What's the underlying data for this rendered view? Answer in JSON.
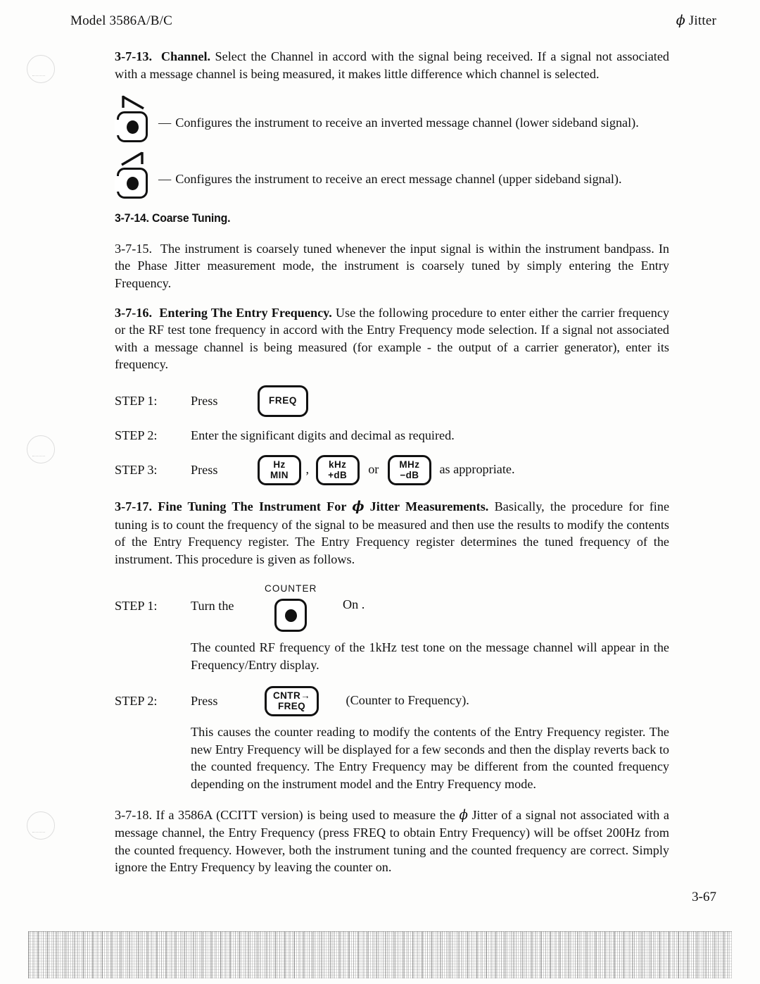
{
  "header": {
    "model": "Model 3586A/B/C",
    "phi": "ϕ",
    "subject": "Jitter"
  },
  "sections": {
    "s13": {
      "number": "3-7-13.",
      "title": "Channel.",
      "body": "Select the Channel in accord with the signal being received. If a signal not associated with a message channel is being measured, it makes little difference which channel is selected."
    },
    "bullets": [
      {
        "icon": "inverted-sideband-slope-icon",
        "dash": "—",
        "text": "Configures the instrument to receive an inverted message channel (lower sideband signal)."
      },
      {
        "icon": "erect-sideband-slope-icon",
        "dash": "—",
        "text": "Configures the instrument to receive an erect message channel (upper sideband signal)."
      }
    ],
    "s14": {
      "heading": "3-7-14.  Coarse Tuning."
    },
    "s15": {
      "number": "3-7-15.",
      "body": "The instrument is coarsely tuned whenever the input signal is within the instrument bandpass. In the Phase Jitter measurement mode, the instrument is coarsely tuned by simply entering the Entry Frequency."
    },
    "s16": {
      "number": "3-7-16.",
      "title": "Entering The Entry Frequency.",
      "body": "Use the following procedure to enter either the carrier frequency or the RF test tone frequency in accord with the Entry Frequency mode selection. If a signal not associated with a message channel is being measured (for example - the output of a carrier generator), enter its frequency.",
      "steps": {
        "step1": {
          "label": "STEP 1:",
          "verb": "Press",
          "key": "FREQ"
        },
        "step2": {
          "label": "STEP 2:",
          "text": "Enter the significant digits and decimal as required."
        },
        "step3": {
          "label": "STEP 3:",
          "verb": "Press",
          "key_hz_line1": "Hz",
          "key_hz_line2": "MIN",
          "separator": ",",
          "key_khz_line1": "kHz",
          "key_khz_line2": "+dB",
          "conjunction": "or",
          "key_mhz_line1": "MHz",
          "key_mhz_line2": "−dB",
          "tail": "as appropriate."
        }
      }
    },
    "s17": {
      "number": "3-7-17.",
      "title_a": "Fine Tuning The Instrument For ",
      "title_phi": "ϕ",
      "title_b": " Jitter Measurements.",
      "body": "Basically, the procedure for fine tuning is to count the frequency of the signal to be measured and then use the results to modify the contents of the Entry Frequency register. The Entry Frequency register determines the tuned frequency of the instrument. This procedure is given as follows.",
      "steps": {
        "step1": {
          "label": "STEP 1:",
          "verb": "Turn the",
          "key_label": "COUNTER",
          "tail": "On  .",
          "note": "The counted RF frequency of the 1kHz test tone on the message channel will appear in the Frequency/Entry display."
        },
        "step2": {
          "label": "STEP 2:",
          "verb": "Press",
          "key_line1": "CNTR→",
          "key_line2": "FREQ",
          "tail": "(Counter to Frequency).",
          "note": "This causes the counter reading to modify the contents of the Entry Frequency register. The new Entry Frequency will be displayed for a few seconds and then the display reverts back to the counted frequency. The Entry Frequency may be different from the counted frequency depending on the instrument model and the Entry Frequency mode."
        }
      }
    },
    "s18": {
      "number": "3-7-18.",
      "body_a": "If a 3586A (CCITT version) is being used to measure the ",
      "body_phi": "ϕ",
      "body_b": " Jitter of a signal not associated with a message channel, the Entry Frequency (press FREQ to obtain Entry Frequency) will be offset 200Hz from the counted frequency. However, both the instrument tuning and the counted frequency are correct. Simply ignore the Entry Frequency by leaving the counter on."
    }
  },
  "footer": {
    "page_number": "3-67"
  }
}
